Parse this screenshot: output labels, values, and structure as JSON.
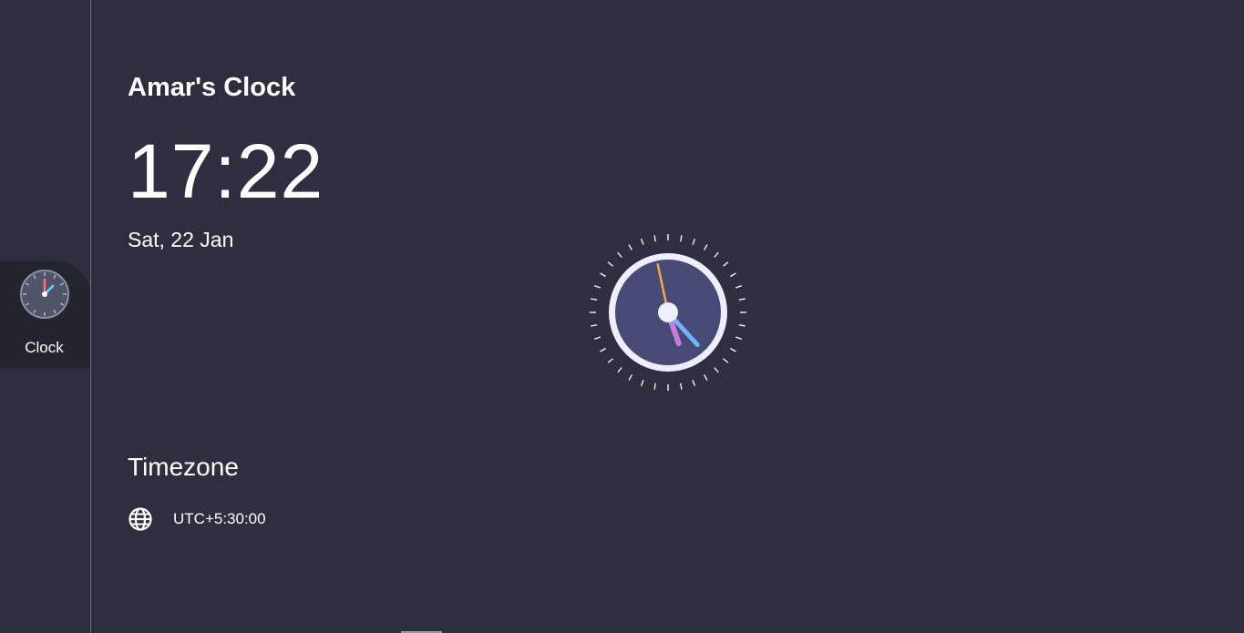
{
  "app": {
    "title": "Amar's Clock"
  },
  "sidebar": {
    "items": [
      {
        "label": "Clock",
        "icon": "analog-clock-icon",
        "active": true
      }
    ]
  },
  "clock": {
    "time": "17:22",
    "date": "Sat, 22 Jan",
    "hours": 17,
    "minutes": 22,
    "seconds": 58
  },
  "timezone": {
    "heading": "Timezone",
    "icon": "globe-icon",
    "value": "UTC+5:30:00"
  },
  "colors": {
    "background": "#2e2e40",
    "sidebar_active": "#24242f",
    "dial_face": "#474a75",
    "dial_ring": "#eeeeff",
    "hour_hand": "#c77ddf",
    "minute_hand": "#6fb2ff",
    "second_hand": "#f2a84a"
  }
}
